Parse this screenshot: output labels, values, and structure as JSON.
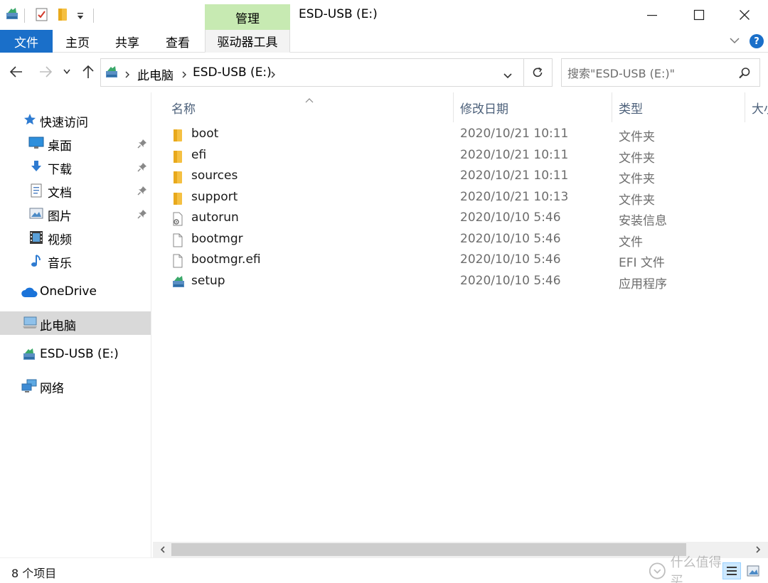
{
  "window": {
    "title": "ESD-USB (E:)",
    "context_tab": "管理",
    "accent": "#1a6fc9",
    "context_color": "#c7eab2"
  },
  "ribbon": {
    "tabs": [
      "文件",
      "主页",
      "共享",
      "查看",
      "驱动器工具"
    ]
  },
  "address": {
    "crumbs": [
      "此电脑",
      "ESD-USB (E:)"
    ]
  },
  "search": {
    "placeholder": "搜索\"ESD-USB (E:)\""
  },
  "sidebar": {
    "quick_access": "快速访问",
    "pinned": [
      {
        "label": "桌面",
        "icon": "desktop-icon"
      },
      {
        "label": "下载",
        "icon": "download-icon"
      },
      {
        "label": "文档",
        "icon": "documents-icon"
      },
      {
        "label": "图片",
        "icon": "pictures-icon"
      }
    ],
    "media": [
      {
        "label": "视频",
        "icon": "video-icon"
      },
      {
        "label": "音乐",
        "icon": "music-icon"
      }
    ],
    "onedrive": "OneDrive",
    "this_pc": "此电脑",
    "drive": "ESD-USB (E:)",
    "network": "网络"
  },
  "columns": {
    "name": "名称",
    "modified": "修改日期",
    "type": "类型",
    "size": "大小"
  },
  "files": [
    {
      "name": "boot",
      "date": "2020/10/21 10:11",
      "type": "文件夹",
      "icon": "folder-icon"
    },
    {
      "name": "efi",
      "date": "2020/10/21 10:11",
      "type": "文件夹",
      "icon": "folder-icon"
    },
    {
      "name": "sources",
      "date": "2020/10/21 10:11",
      "type": "文件夹",
      "icon": "folder-icon"
    },
    {
      "name": "support",
      "date": "2020/10/21 10:13",
      "type": "文件夹",
      "icon": "folder-icon"
    },
    {
      "name": "autorun",
      "date": "2020/10/10 5:46",
      "type": "安装信息",
      "icon": "setup-info-icon"
    },
    {
      "name": "bootmgr",
      "date": "2020/10/10 5:46",
      "type": "文件",
      "icon": "file-icon"
    },
    {
      "name": "bootmgr.efi",
      "date": "2020/10/10 5:46",
      "type": "EFI 文件",
      "icon": "file-icon"
    },
    {
      "name": "setup",
      "date": "2020/10/10 5:46",
      "type": "应用程序",
      "icon": "setup-app-icon"
    }
  ],
  "status": {
    "count": "8 个项目"
  },
  "watermark": "什么值得买"
}
